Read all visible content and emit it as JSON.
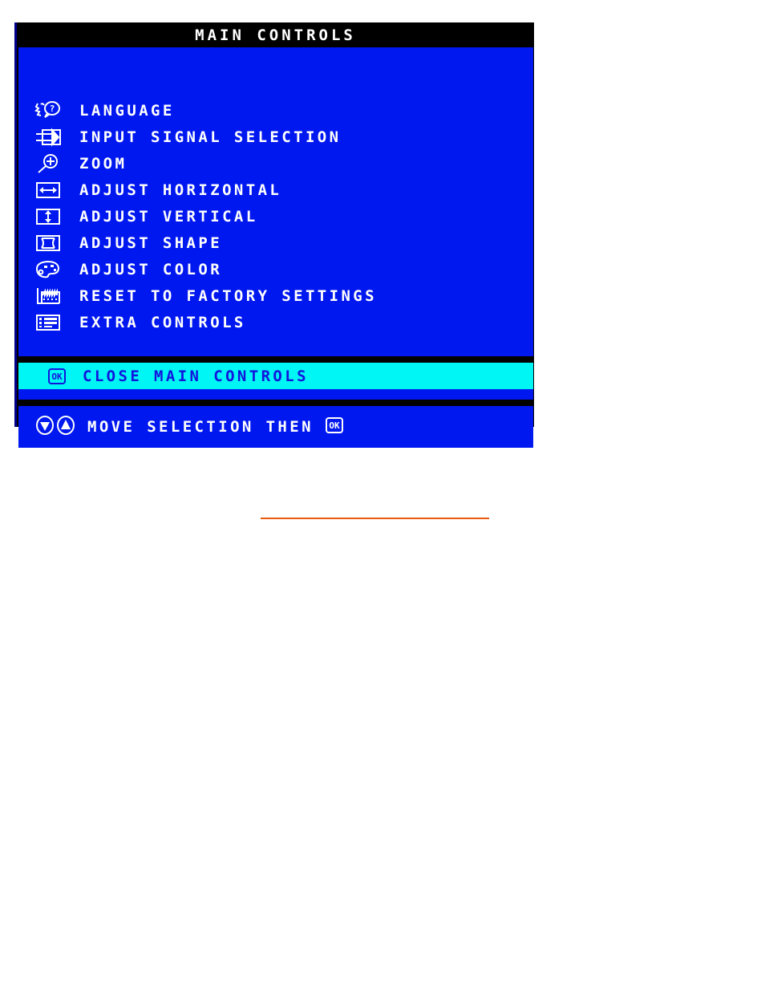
{
  "osd": {
    "title": "MAIN CONTROLS",
    "colors": {
      "panel_border": "#00008b",
      "title_bar_bg": "#000000",
      "title_text": "#ffffff",
      "body_bg": "#0018f0",
      "menu_text": "#ffffff",
      "highlight_bg": "#00f5f5",
      "highlight_text": "#1414dc",
      "separator": "#000000",
      "orange_rule": "#e8590c"
    },
    "menu_items": [
      {
        "icon": "language-face-question-icon",
        "label": "LANGUAGE"
      },
      {
        "icon": "input-signal-arrow-icon",
        "label": "INPUT SIGNAL SELECTION"
      },
      {
        "icon": "zoom-magnifier-plus-icon",
        "label": "ZOOM"
      },
      {
        "icon": "adjust-horizontal-arrows-icon",
        "label": "ADJUST HORIZONTAL"
      },
      {
        "icon": "adjust-vertical-arrows-icon",
        "label": "ADJUST VERTICAL"
      },
      {
        "icon": "adjust-shape-pincushion-icon",
        "label": "ADJUST SHAPE"
      },
      {
        "icon": "adjust-color-palette-icon",
        "label": "ADJUST COLOR"
      },
      {
        "icon": "factory-reset-icon",
        "label": "RESET TO FACTORY SETTINGS"
      },
      {
        "icon": "extra-controls-list-icon",
        "label": "EXTRA CONTROLS"
      }
    ],
    "selected_item": {
      "icon": "ok-button-icon",
      "label": "CLOSE MAIN CONTROLS"
    },
    "footer": {
      "down_icon": "arrow-down-circle-icon",
      "up_icon": "arrow-up-circle-icon",
      "label": "MOVE SELECTION THEN",
      "ok_icon": "ok-button-icon"
    }
  }
}
